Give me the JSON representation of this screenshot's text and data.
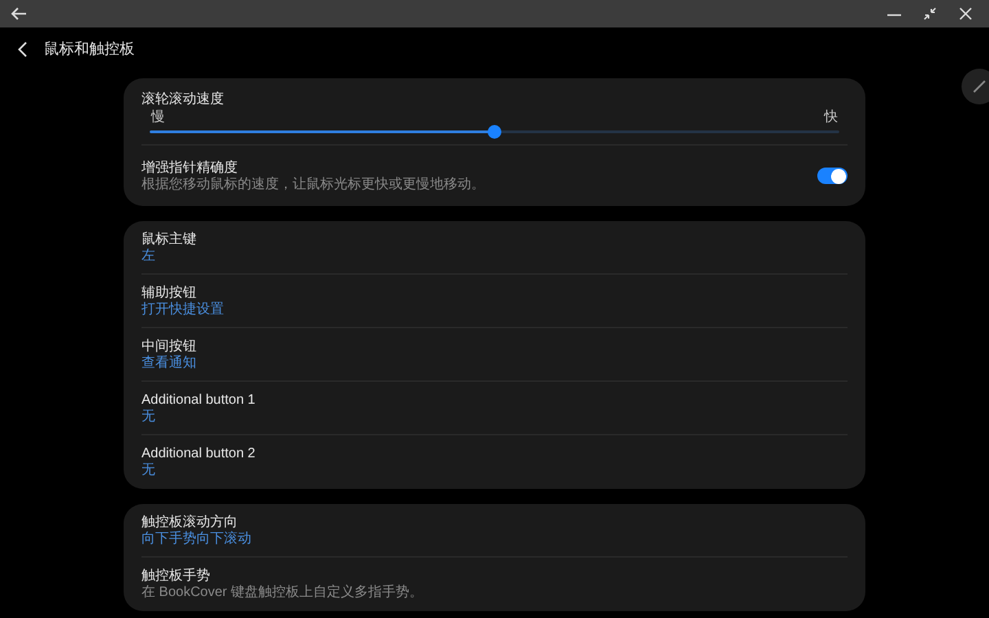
{
  "header": {
    "title": "鼠标和触控板"
  },
  "sections": [
    {
      "items": [
        {
          "kind": "slider",
          "title": "滚轮滚动速度",
          "min_label": "慢",
          "max_label": "快",
          "level": 0.5
        },
        {
          "kind": "toggle",
          "title": "增强指针精确度",
          "description": "根据您移动鼠标的速度，让鼠标光标更快或更慢地移动。",
          "on": true
        }
      ]
    },
    {
      "items": [
        {
          "kind": "option",
          "title": "鼠标主键",
          "value": "左"
        },
        {
          "kind": "option",
          "title": "辅助按钮",
          "value": "打开快捷设置"
        },
        {
          "kind": "option",
          "title": "中间按钮",
          "value": "查看通知"
        },
        {
          "kind": "option",
          "title": "Additional button 1",
          "value": "无"
        },
        {
          "kind": "option",
          "title": "Additional button 2",
          "value": "无"
        }
      ]
    },
    {
      "items": [
        {
          "kind": "option",
          "title": "触控板滚动方向",
          "value": "向下手势向下滚动"
        },
        {
          "kind": "option",
          "title": "触控板手势",
          "description": "在 BookCover 键盘触控板上自定义多指手势。"
        }
      ]
    }
  ]
}
